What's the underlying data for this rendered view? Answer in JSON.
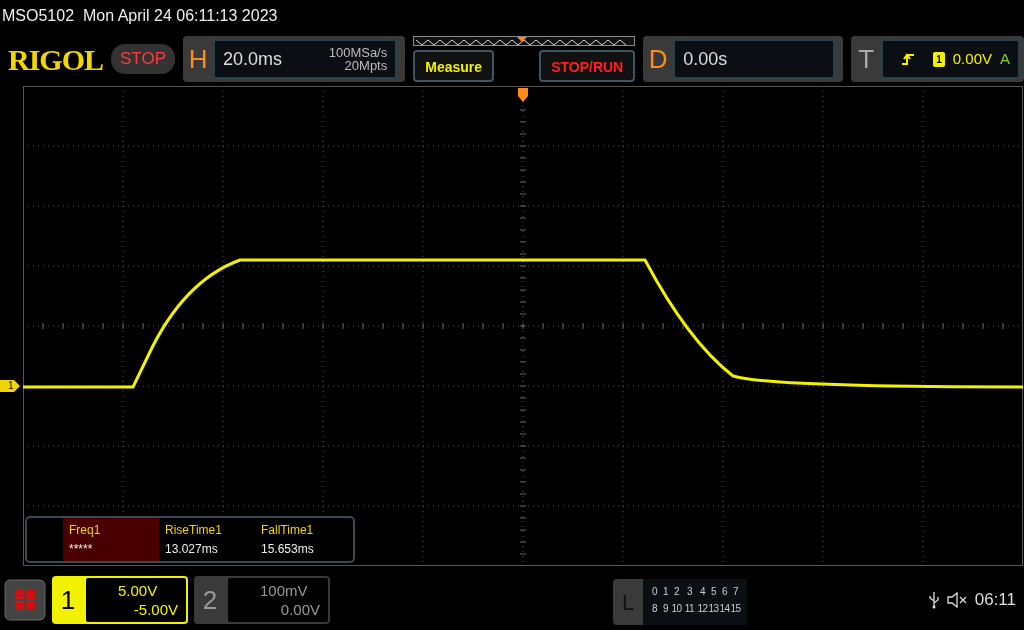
{
  "status_bar": {
    "model": "MSO5102",
    "datetime": "Mon April 24 06:11:13 2023"
  },
  "toolbar": {
    "logo": "RIGOL",
    "run_state": "STOP",
    "horizontal": {
      "label": "H",
      "timebase": "20.0ms",
      "sample_rate": "100MSa/s",
      "memory_depth": "20Mpts"
    },
    "buttons": [
      {
        "label": "Measure",
        "kind": "measure"
      },
      {
        "label": "STOP/RUN",
        "kind": "stoprun"
      }
    ],
    "delay": {
      "label": "D",
      "value": "0.00s"
    },
    "trigger": {
      "label": "T",
      "source": "1",
      "level": "0.00V",
      "mode": "A"
    }
  },
  "graticule": {
    "channel_marker": "1"
  },
  "measurements": [
    {
      "name": "Freq1",
      "value": "*****",
      "selected": true
    },
    {
      "name": "RiseTime1",
      "value": "13.027ms",
      "selected": false
    },
    {
      "name": "FallTime1",
      "value": "15.653ms",
      "selected": false
    }
  ],
  "channels": [
    {
      "number": "1",
      "scale": "5.00V",
      "offset": "-5.00V",
      "on": true
    },
    {
      "number": "2",
      "scale": "100mV",
      "offset": "0.00V",
      "on": false
    }
  ],
  "logic": {
    "label": "L",
    "rows": [
      [
        "0",
        "1",
        "2",
        "3",
        "4",
        "5",
        "6",
        "7"
      ],
      [
        "8",
        "9",
        "10",
        "11",
        "12",
        "13",
        "14",
        "15"
      ]
    ]
  },
  "system": {
    "time": "06:11"
  }
}
